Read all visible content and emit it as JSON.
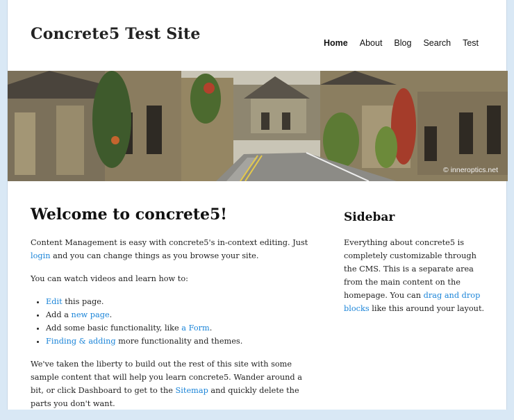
{
  "site": {
    "title": "Concrete5 Test Site"
  },
  "nav": {
    "items": [
      {
        "label": "Home",
        "active": true
      },
      {
        "label": "About"
      },
      {
        "label": "Blog"
      },
      {
        "label": "Search"
      },
      {
        "label": "Test"
      }
    ]
  },
  "hero": {
    "credit": "© inneroptics.net"
  },
  "main": {
    "heading": "Welcome to concrete5!",
    "p1": {
      "before": "Content Management is easy with concrete5's in-context editing. Just ",
      "link": "login",
      "after": " and you can change things as you browse your site."
    },
    "p2": "You can watch videos and learn how to:",
    "list": [
      {
        "link": "Edit",
        "after": " this page."
      },
      {
        "before": "Add a ",
        "link": "new page",
        "after": "."
      },
      {
        "before": "Add some basic functionality, like ",
        "link": "a Form",
        "after": "."
      },
      {
        "link": "Finding & adding",
        "after": " more functionality and themes."
      }
    ],
    "p3": {
      "before": "We've taken the liberty to build out the rest of this site with some sample content that will help you learn concrete5. Wander around a bit, or click Dashboard to get to the ",
      "link": "Sitemap",
      "after": " and quickly delete the parts you don't want."
    }
  },
  "sidebar": {
    "heading": "Sidebar",
    "text_before": "Everything about concrete5 is completely customizable through the CMS. This is a separate area from the main content on the homepage. You can ",
    "link": "drag and drop blocks",
    "text_after": " like this around your layout."
  },
  "colors": {
    "link": "#1a84d8",
    "background": "#d9e8f5"
  }
}
